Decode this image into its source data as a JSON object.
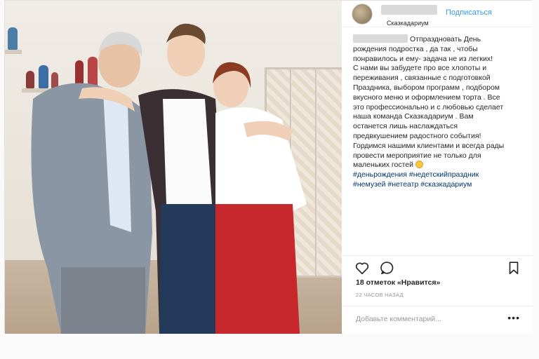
{
  "post": {
    "follow_label": "Подписаться",
    "location": "Сказкадариум",
    "caption_lines": [
      "Отпраздновать День",
      "рождения подростка , да так , чтобы",
      "понравилось и ему- задача не из легких!",
      "С нами вы забудете про все хлопоты и",
      "переживания , связанные с подготовкой",
      "Праздника, выбором программ , подбором",
      "вкусного меню и оформлением торта . Все",
      "это профессионально и с любовью сделает",
      "наша команда Сказкадариум . Вам",
      "останется лишь наслаждаться",
      "предвкушением радостного события!",
      "Гордимся нашими клиентами и всегда рады",
      "провести мероприятие не только для",
      "маленьких гостей"
    ],
    "hashtags_line1": "#деньрождения #недетскийпраздник",
    "hashtags_line2": "#немузей #нетеатр #сказкадариум",
    "likes": "18 отметок «Нравится»",
    "time": "22 ЧАСОВ НАЗАД",
    "comment_placeholder": "Добавьте комментарий...",
    "more_label": "•••"
  },
  "icons": {
    "like": "heart-icon",
    "comment": "comment-icon",
    "save": "bookmark-icon",
    "more": "more-icon"
  },
  "colors": {
    "link": "#3897f0",
    "hashtag": "#003569",
    "muted": "#999999"
  }
}
